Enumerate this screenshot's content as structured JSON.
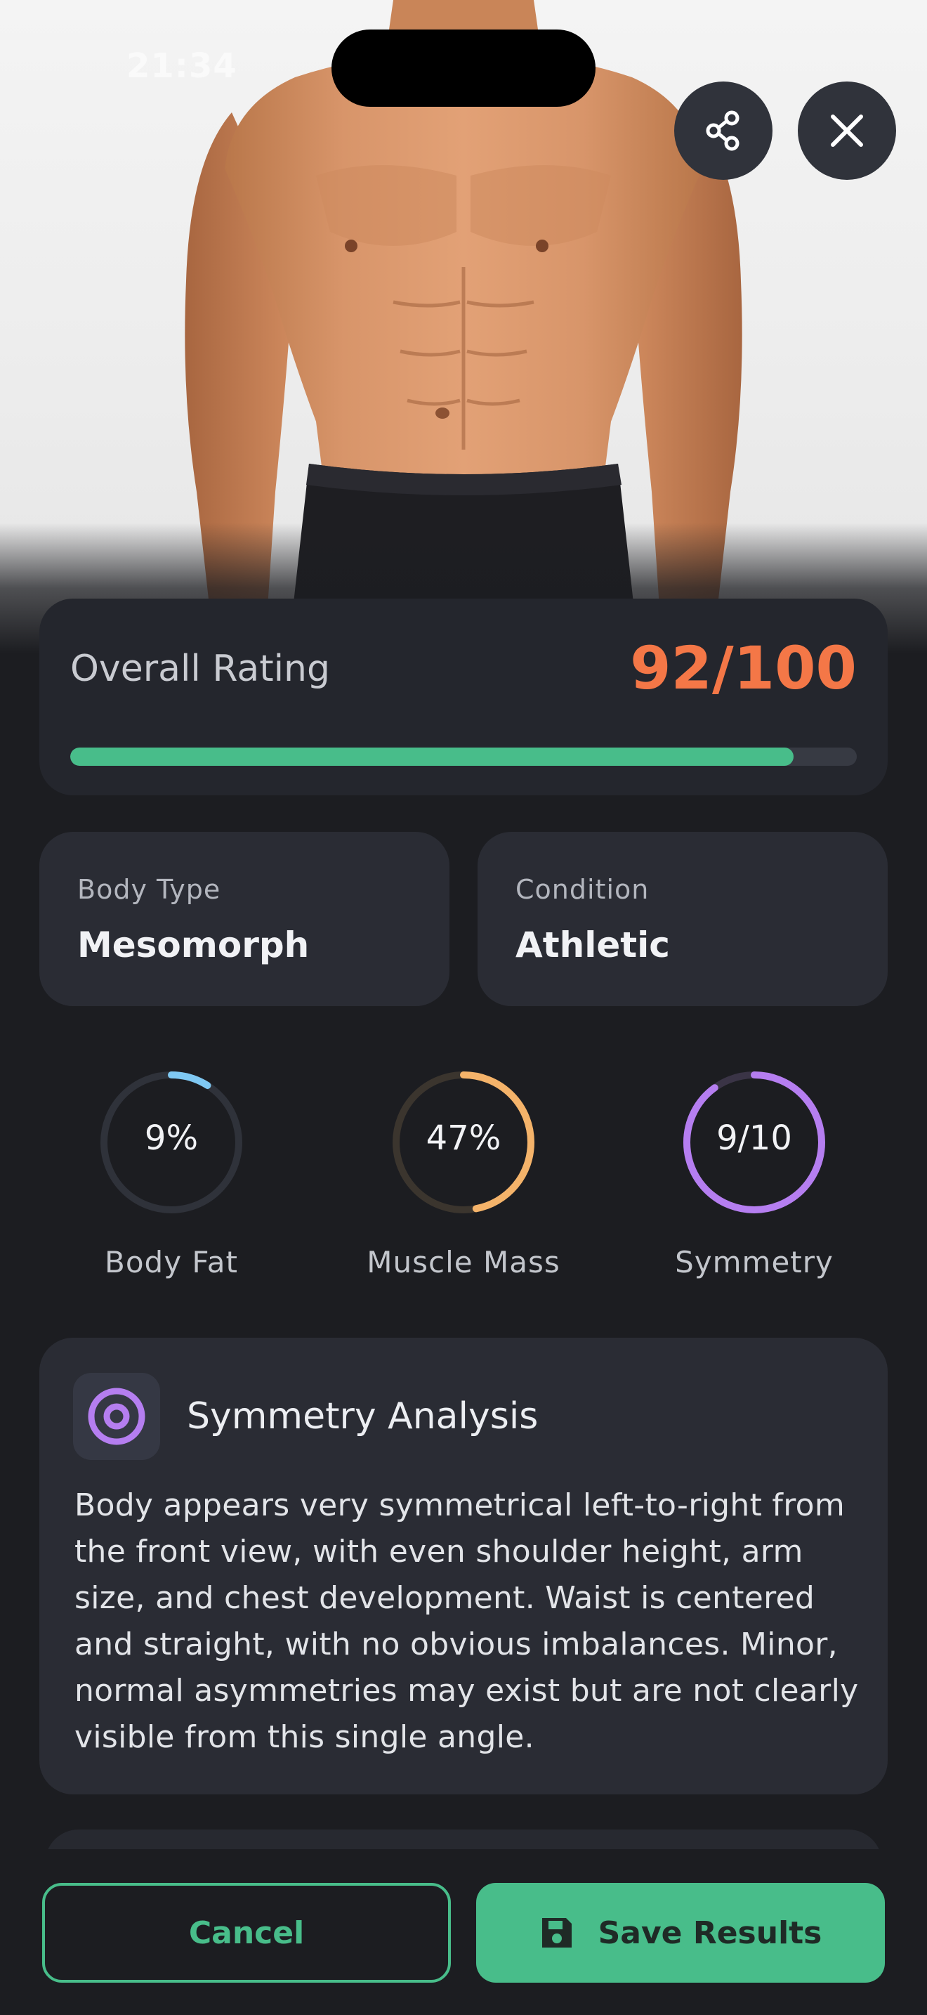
{
  "status_bar": {
    "time": "21:34"
  },
  "header": {
    "share_icon": "share-icon",
    "close_icon": "close-icon"
  },
  "overall_rating": {
    "label": "Overall Rating",
    "value_text": "92/100",
    "score": 92,
    "max": 100,
    "bar_color": "#48bd8a",
    "value_color": "#f47747"
  },
  "stats": {
    "body_type": {
      "label": "Body Type",
      "value": "Mesomorph"
    },
    "condition": {
      "label": "Condition",
      "value": "Athletic"
    }
  },
  "metrics": [
    {
      "label": "Body Fat",
      "value_text": "9%",
      "fraction": 0.09,
      "color": "#7fc8f2",
      "track": "#2f323a"
    },
    {
      "label": "Muscle Mass",
      "value_text": "47%",
      "fraction": 0.47,
      "color": "#f4b36a",
      "track": "#3b352e"
    },
    {
      "label": "Symmetry",
      "value_text": "9/10",
      "fraction": 0.9,
      "color": "#b57ef0",
      "track": "#3a3446"
    }
  ],
  "symmetry_analysis": {
    "icon": "target-icon",
    "title": "Symmetry Analysis",
    "body": "Body appears very symmetrical left-to-right from the front view, with even shoulder height, arm size, and chest development. Waist is centered and straight, with no obvious imbalances. Minor, normal asymmetries may exist but are not clearly visible from this single angle."
  },
  "actions": {
    "cancel_label": "Cancel",
    "save_label": "Save Results",
    "save_icon": "save-icon",
    "accent": "#48bd8a"
  }
}
